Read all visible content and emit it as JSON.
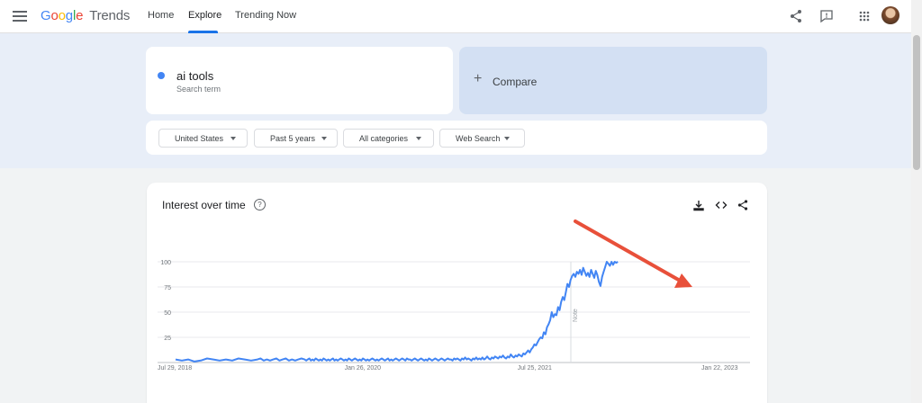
{
  "header": {
    "logo_google": "Google",
    "logo_trends": "Trends",
    "nav": [
      {
        "label": "Home"
      },
      {
        "label": "Explore"
      },
      {
        "label": "Trending Now"
      }
    ]
  },
  "search": {
    "term": "ai tools",
    "term_type": "Search term",
    "compare_label": "Compare"
  },
  "filters": [
    "United States",
    "Past 5 years",
    "All categories",
    "Web Search"
  ],
  "card": {
    "title": "Interest over time",
    "help": "?"
  },
  "chart_data": {
    "type": "line",
    "series": [
      {
        "name": "ai tools",
        "color": "#4285f4"
      }
    ],
    "y_ticks": [
      "100",
      "75",
      "50",
      "25"
    ],
    "x_tick_labels": [
      "Jul 29, 2018",
      "Jan 26, 2020",
      "Jul 25, 2021",
      "Jan 22, 2023"
    ],
    "note_label": "Note",
    "ylim": [
      0,
      100
    ],
    "grid": true,
    "x_start": "Jul 29, 2018",
    "x": [
      0,
      20,
      40,
      60,
      80,
      100,
      120,
      140,
      160,
      180,
      200,
      220,
      240,
      260,
      270,
      280,
      290,
      300,
      310,
      320,
      330,
      340,
      350,
      360,
      370,
      380,
      390,
      400,
      410,
      415,
      420,
      425,
      430,
      435,
      440,
      445,
      450,
      455,
      460,
      465,
      470,
      475,
      480,
      485,
      490,
      495,
      500,
      505,
      510,
      515,
      520,
      525,
      530,
      535,
      540,
      545,
      550,
      555,
      560,
      565,
      570,
      575,
      580,
      585,
      590,
      595,
      600,
      605,
      610,
      615,
      620,
      625,
      630,
      635,
      640,
      645,
      650,
      655,
      660,
      665,
      670,
      675,
      680,
      685,
      690,
      695,
      700,
      705,
      710,
      715,
      720,
      725,
      730,
      735,
      740,
      745,
      750,
      755,
      760,
      765,
      770,
      775,
      780,
      785,
      790,
      795,
      800,
      805,
      810,
      815,
      820,
      825,
      830,
      835,
      840,
      845,
      850,
      855,
      860,
      865,
      870,
      875,
      880,
      885,
      890,
      895,
      900,
      905,
      910,
      915,
      920,
      925,
      930,
      935,
      940,
      945,
      950,
      955,
      960,
      965,
      970,
      975,
      980,
      985,
      990,
      995,
      1000,
      1005,
      1010,
      1015,
      1020,
      1025,
      1030,
      1035,
      1040,
      1045,
      1050,
      1055,
      1060,
      1065,
      1070,
      1075,
      1080,
      1085,
      1090,
      1095,
      1100,
      1105,
      1110,
      1115,
      1120,
      1125,
      1130,
      1135,
      1140,
      1145,
      1150,
      1155,
      1160,
      1165,
      1170,
      1175,
      1180,
      1185,
      1190,
      1195,
      1200,
      1205,
      1210,
      1215,
      1220,
      1225,
      1230,
      1235,
      1240,
      1245,
      1250,
      1255,
      1260,
      1265,
      1270,
      1275,
      1280,
      1285,
      1290,
      1295,
      1300,
      1305,
      1310,
      1315,
      1320,
      1325,
      1330,
      1335,
      1340,
      1345,
      1350,
      1355,
      1360,
      1365,
      1370,
      1375,
      1380,
      1385,
      1390,
      1395,
      1400,
      1405,
      1410,
      1415,
      1420,
      1425,
      1430,
      1435,
      1440,
      1445,
      1450,
      1455,
      1460,
      1465,
      1470,
      1475,
      1480,
      1485,
      1490,
      1495,
      1500,
      1505,
      1510,
      1515,
      1520,
      1525,
      1530,
      1535,
      1540,
      1545,
      1550,
      1555,
      1560,
      1565,
      1570,
      1575,
      1580,
      1585,
      1590,
      1595,
      1600,
      1605,
      1610,
      1615,
      1620,
      1625,
      1630,
      1635,
      1640,
      1645,
      1650,
      1655,
      1660,
      1665,
      1670,
      1675,
      1680,
      1685,
      1690,
      1695,
      1700,
      1705,
      1710,
      1715,
      1720,
      1725,
      1730,
      1735,
      1740,
      1745,
      1750,
      1755,
      1760,
      1765,
      1770,
      1775,
      1780,
      1785,
      1790,
      1795,
      1800,
      1805,
      1810,
      1815,
      1820,
      1825
    ],
    "values": [
      3,
      2,
      3,
      1,
      2,
      4,
      3,
      2,
      3,
      2,
      4,
      3,
      2,
      3,
      4,
      2,
      3,
      2,
      3,
      4,
      2,
      3,
      4,
      2,
      3,
      2,
      3,
      4,
      3,
      2,
      3,
      4,
      2,
      3,
      2,
      4,
      3,
      2,
      3,
      2,
      4,
      3,
      2,
      3,
      2,
      3,
      4,
      2,
      3,
      2,
      3,
      4,
      3,
      2,
      3,
      2,
      4,
      3,
      2,
      3,
      4,
      3,
      2,
      3,
      2,
      4,
      3,
      2,
      3,
      2,
      3,
      4,
      3,
      2,
      3,
      2,
      3,
      4,
      3,
      2,
      3,
      4,
      2,
      3,
      2,
      3,
      4,
      3,
      2,
      3,
      4,
      3,
      2,
      4,
      3,
      3,
      2,
      3,
      4,
      3,
      2,
      3,
      4,
      3,
      2,
      3,
      2,
      4,
      3,
      2,
      3,
      4,
      3,
      2,
      3,
      4,
      3,
      2,
      3,
      4,
      3,
      3,
      2,
      4,
      3,
      4,
      3,
      2,
      4,
      3,
      5,
      3,
      4,
      3,
      2,
      4,
      3,
      5,
      3,
      4,
      3,
      5,
      3,
      4,
      6,
      4,
      3,
      5,
      4,
      6,
      5,
      4,
      6,
      5,
      7,
      5,
      4,
      6,
      5,
      8,
      6,
      5,
      7,
      6,
      8,
      7,
      6,
      9,
      8,
      10,
      12,
      10,
      13,
      15,
      18,
      17,
      20,
      23,
      25,
      24,
      30,
      28,
      35,
      38,
      42,
      50,
      45,
      48,
      47,
      55,
      52,
      60,
      65,
      62,
      70,
      78,
      75,
      82,
      86,
      88,
      85,
      90,
      88,
      92,
      87,
      94,
      90,
      86,
      89,
      85,
      92,
      88,
      84,
      91,
      87,
      80,
      76,
      85,
      90,
      95,
      100,
      98,
      96,
      100,
      97,
      100,
      99,
      100
    ]
  },
  "icons": {
    "menu": "hamburger-icon",
    "share": "share-icon",
    "feedback": "feedback-icon",
    "apps": "apps-grid-icon",
    "download": "download-icon",
    "embed": "embed-code-icon",
    "card_share": "share-icon"
  },
  "colors": {
    "accent": "#1a73e8",
    "series": "#4285f4",
    "arrow": "#e8503a"
  }
}
